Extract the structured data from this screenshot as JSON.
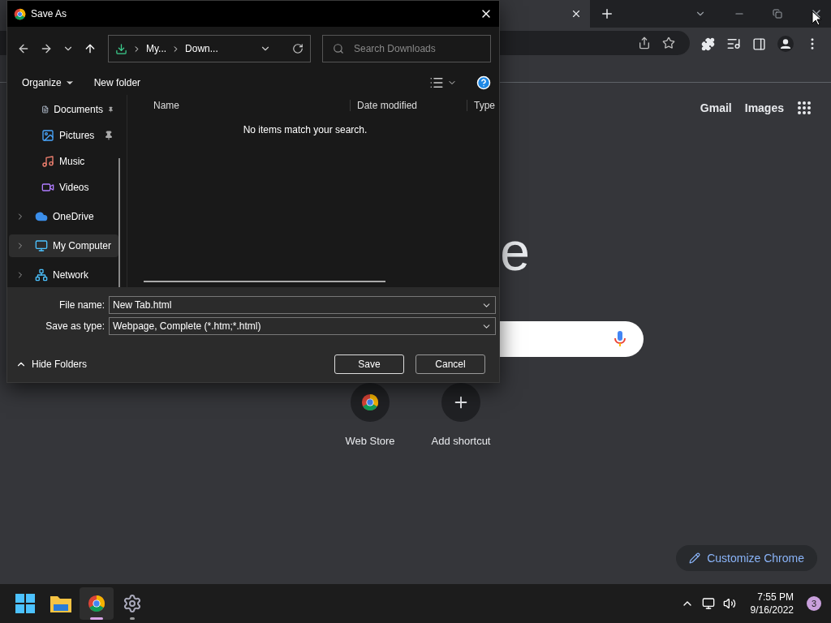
{
  "browser": {
    "header_links": [
      "Gmail",
      "Images"
    ],
    "logo_visible": "e",
    "shortcuts": [
      {
        "kind": "webstore",
        "label": "Web Store"
      },
      {
        "kind": "add",
        "label": "Add shortcut"
      }
    ],
    "customize_button": "Customize Chrome"
  },
  "dialog": {
    "title": "Save As",
    "breadcrumb": [
      "My...",
      "Down..."
    ],
    "search_placeholder": "Search Downloads",
    "commands": [
      "Organize",
      "New folder"
    ],
    "nav_items": [
      {
        "kind": "documents",
        "label": "Documents",
        "pinned": true,
        "expandable": false,
        "selected": false
      },
      {
        "kind": "pictures",
        "label": "Pictures",
        "pinned": true,
        "expandable": false,
        "selected": false
      },
      {
        "kind": "music",
        "label": "Music",
        "pinned": false,
        "expandable": false,
        "selected": false
      },
      {
        "kind": "videos",
        "label": "Videos",
        "pinned": false,
        "expandable": false,
        "selected": false
      },
      {
        "kind": "cloud",
        "label": "OneDrive",
        "pinned": false,
        "expandable": true,
        "selected": false
      },
      {
        "kind": "computer",
        "label": "My Computer",
        "pinned": false,
        "expandable": true,
        "selected": true
      },
      {
        "kind": "network",
        "label": "Network",
        "pinned": false,
        "expandable": true,
        "selected": false
      }
    ],
    "columns": [
      "Name",
      "Date modified",
      "Type"
    ],
    "empty_message": "No items match your search.",
    "file_name": {
      "label": "File name:",
      "value": "New Tab.html"
    },
    "save_type": {
      "label": "Save as type:",
      "value": "Webpage, Complete (*.htm;*.html)"
    },
    "hide_folders": "Hide Folders",
    "buttons": [
      {
        "label": "Save",
        "default": true
      },
      {
        "label": "Cancel",
        "default": false
      }
    ]
  },
  "taskbar": {
    "apps": [
      {
        "kind": "start",
        "selected": false,
        "running": false
      },
      {
        "kind": "explorer",
        "selected": false,
        "running": false
      },
      {
        "kind": "chrome",
        "selected": true,
        "running": true
      },
      {
        "kind": "settings",
        "selected": false,
        "running": true
      }
    ],
    "time": "7:55 PM",
    "date": "9/16/2022",
    "notifications": "3"
  }
}
